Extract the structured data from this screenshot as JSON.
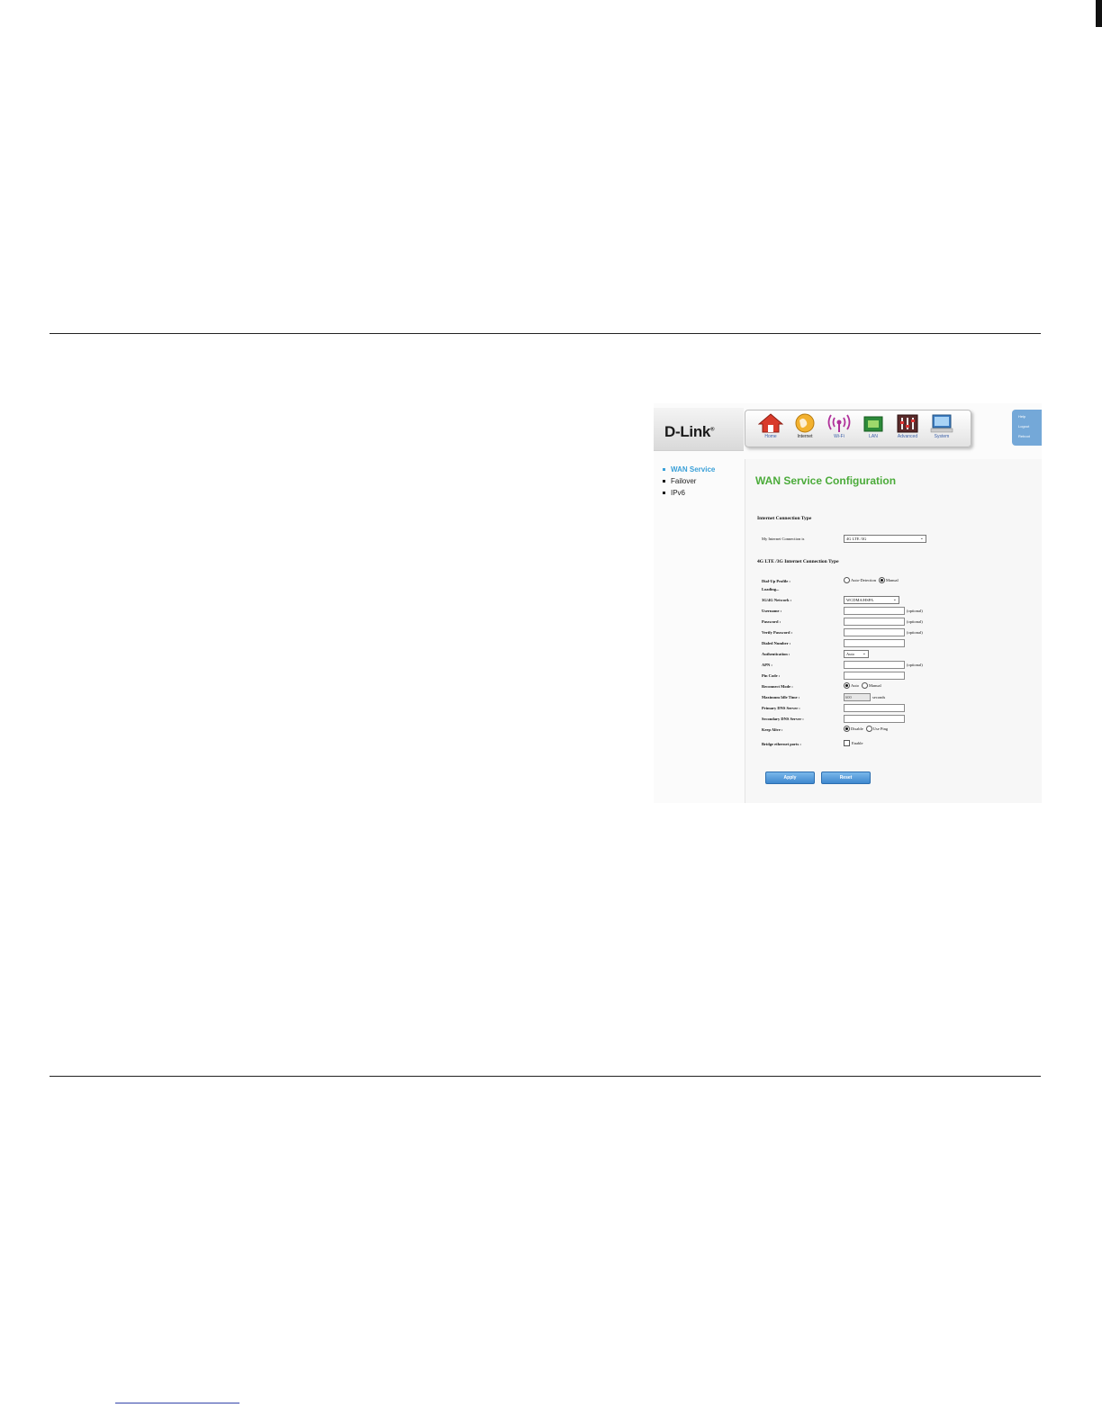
{
  "app": {
    "logo_text": "D-Link",
    "logo_mark": "®",
    "nav": [
      {
        "label": "Home",
        "icon": "home-icon"
      },
      {
        "label": "Internet",
        "icon": "globe-icon"
      },
      {
        "label": "Wi-Fi",
        "icon": "wifi-icon"
      },
      {
        "label": "LAN",
        "icon": "lan-icon"
      },
      {
        "label": "Advanced",
        "icon": "advanced-icon"
      },
      {
        "label": "System",
        "icon": "monitor-icon"
      }
    ],
    "util_links": [
      "Help",
      "Logout",
      "Reboot"
    ]
  },
  "sidebar": {
    "items": [
      {
        "label": "WAN Service",
        "active": true
      },
      {
        "label": "Failover",
        "active": false
      },
      {
        "label": "IPv6",
        "active": false
      }
    ]
  },
  "main": {
    "title": "WAN Service Configuration",
    "section1": "Internet Connection Type",
    "connection_label": "My Internet Connection is",
    "connection_value": "4G LTE /3G",
    "section2": "4G LTE /3G Internet Connection Type",
    "dialup_label": "Dial-Up Profile :",
    "dialup_opt_auto": "Auto-Detection",
    "dialup_opt_manual": "Manual",
    "loading": "Loading...",
    "network_label": "3G/4G Network :",
    "network_value": "WCDMA/HSPA",
    "username_label": "Username :",
    "password_label": "Password :",
    "verify_label": "Verify Password :",
    "dialed_label": "Dialed Number :",
    "auth_label": "Authentication :",
    "auth_value": "Auto",
    "apn_label": "APN :",
    "pin_label": "Pin Code :",
    "reconnect_label": "Reconnect Mode :",
    "reconnect_opt_auto": "Auto",
    "reconnect_opt_manual": "Manual",
    "idle_label": "Maximum Idle Time :",
    "idle_value": "600",
    "idle_unit": "seconds",
    "dns1_label": "Primary DNS Server :",
    "dns2_label": "Secondary DNS Server :",
    "keepalive_label": "Keep Alive :",
    "keepalive_opt_disable": "Disable",
    "keepalive_opt_ping": "Use Ping",
    "bridge_label": "Bridge ethernet ports :",
    "bridge_opt": "Enable",
    "optional": "(optional)",
    "apply_label": "Apply",
    "reset_label": "Reset"
  }
}
